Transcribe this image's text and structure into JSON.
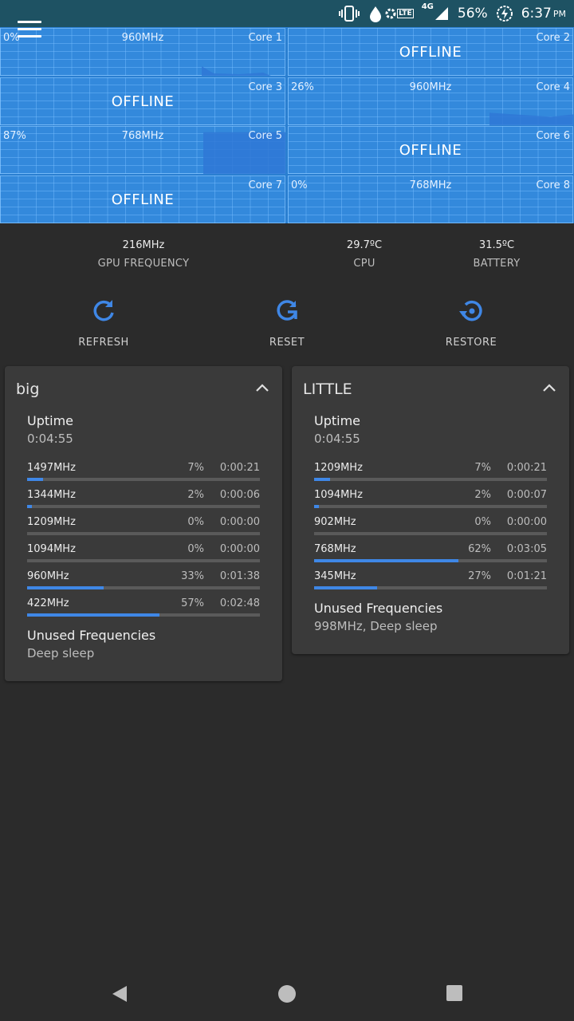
{
  "status_bar": {
    "battery": "56%",
    "time": "6:37",
    "ampm": "PM",
    "network": "4G",
    "lte": "LTE",
    "icons": [
      "vibrate-icon",
      "data-saver-icon",
      "volte-icon",
      "signal-icon",
      "battery-charging-icon"
    ]
  },
  "cores": [
    {
      "pct": "0%",
      "freq": "960MHz",
      "label": "Core 1",
      "offline": "",
      "load": 0.1
    },
    {
      "pct": "",
      "freq": "",
      "label": "Core 2",
      "offline": "OFFLINE",
      "load": 0
    },
    {
      "pct": "",
      "freq": "",
      "label": "Core 3",
      "offline": "OFFLINE",
      "load": 0
    },
    {
      "pct": "26%",
      "freq": "960MHz",
      "label": "Core 4",
      "offline": "",
      "load": 0.26
    },
    {
      "pct": "87%",
      "freq": "768MHz",
      "label": "Core 5",
      "offline": "",
      "load": 0.87
    },
    {
      "pct": "",
      "freq": "",
      "label": "Core 6",
      "offline": "OFFLINE",
      "load": 0
    },
    {
      "pct": "",
      "freq": "",
      "label": "Core 7",
      "offline": "OFFLINE",
      "load": 0
    },
    {
      "pct": "0%",
      "freq": "768MHz",
      "label": "Core 8",
      "offline": "",
      "load": 0
    }
  ],
  "stats": {
    "gpu": {
      "value": "216MHz",
      "label": "GPU FREQUENCY"
    },
    "cpu": {
      "value": "29.7ºC",
      "label": "CPU"
    },
    "battery": {
      "value": "31.5ºC",
      "label": "BATTERY"
    }
  },
  "actions": {
    "refresh": "REFRESH",
    "reset": "RESET",
    "restore": "RESTORE"
  },
  "clusters": [
    {
      "title": "big",
      "uptime_label": "Uptime",
      "uptime": "0:04:55",
      "states": [
        {
          "freq": "1497MHz",
          "pct": "7%",
          "time": "0:00:21",
          "value": 7
        },
        {
          "freq": "1344MHz",
          "pct": "2%",
          "time": "0:00:06",
          "value": 2
        },
        {
          "freq": "1209MHz",
          "pct": "0%",
          "time": "0:00:00",
          "value": 0
        },
        {
          "freq": "1094MHz",
          "pct": "0%",
          "time": "0:00:00",
          "value": 0
        },
        {
          "freq": "960MHz",
          "pct": "33%",
          "time": "0:01:38",
          "value": 33
        },
        {
          "freq": "422MHz",
          "pct": "57%",
          "time": "0:02:48",
          "value": 57
        }
      ],
      "unused_label": "Unused Frequencies",
      "unused": "Deep sleep"
    },
    {
      "title": "LITTLE",
      "uptime_label": "Uptime",
      "uptime": "0:04:55",
      "states": [
        {
          "freq": "1209MHz",
          "pct": "7%",
          "time": "0:00:21",
          "value": 7
        },
        {
          "freq": "1094MHz",
          "pct": "2%",
          "time": "0:00:07",
          "value": 2
        },
        {
          "freq": "902MHz",
          "pct": "0%",
          "time": "0:00:00",
          "value": 0
        },
        {
          "freq": "768MHz",
          "pct": "62%",
          "time": "0:03:05",
          "value": 62
        },
        {
          "freq": "345MHz",
          "pct": "27%",
          "time": "0:01:21",
          "value": 27
        }
      ],
      "unused_label": "Unused Frequencies",
      "unused": "998MHz, Deep sleep"
    }
  ],
  "colors": {
    "accent": "#3f87e6",
    "status_bar": "#1e5263",
    "graph": "#3389dc",
    "background": "#2b2b2b",
    "card": "#3a3a3a"
  }
}
